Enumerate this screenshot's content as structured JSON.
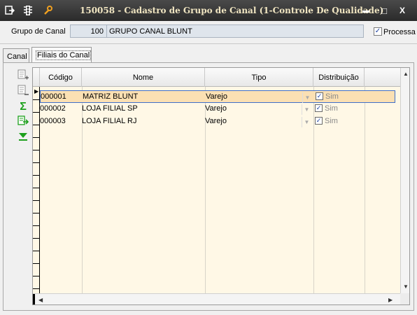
{
  "window": {
    "title": "150058 - Cadastro de Grupo de Canal (1-Controle De Qualidade)",
    "minimize": "▬",
    "maximize": "□",
    "close": "X"
  },
  "header": {
    "grupo_label": "Grupo de Canal",
    "grupo_code": "100",
    "grupo_name": "GRUPO CANAL BLUNT",
    "processa_label": "Processa",
    "processa_checked": true
  },
  "tabs": [
    {
      "label": "Canal",
      "active": false
    },
    {
      "label": "Filiais do Canal",
      "active": true
    }
  ],
  "toolbar": {
    "icons": [
      "add-row-icon",
      "remove-row-icon",
      "sum-icon",
      "export-icon",
      "filter-icon"
    ],
    "sum_glyph": "Σ"
  },
  "grid": {
    "columns": [
      "Código",
      "Nome",
      "Tipo",
      "Distribuição"
    ],
    "rows": [
      {
        "codigo": "000001",
        "nome": "MATRIZ BLUNT",
        "tipo": "Varejo",
        "distribuicao": "Sim",
        "checked": true,
        "selected": true
      },
      {
        "codigo": "000002",
        "nome": "LOJA FILIAL SP",
        "tipo": "Varejo",
        "distribuicao": "Sim",
        "checked": true,
        "selected": false
      },
      {
        "codigo": "000003",
        "nome": "LOJA FILIAL RJ",
        "tipo": "Varejo",
        "distribuicao": "Sim",
        "checked": true,
        "selected": false
      }
    ]
  },
  "colors": {
    "titlebar": "#2f2f2f",
    "title_text": "#f1e6c2",
    "grid_bg": "#fff8e6",
    "selected_row": "#fbe0b3",
    "sum_green": "#1ca01c"
  }
}
